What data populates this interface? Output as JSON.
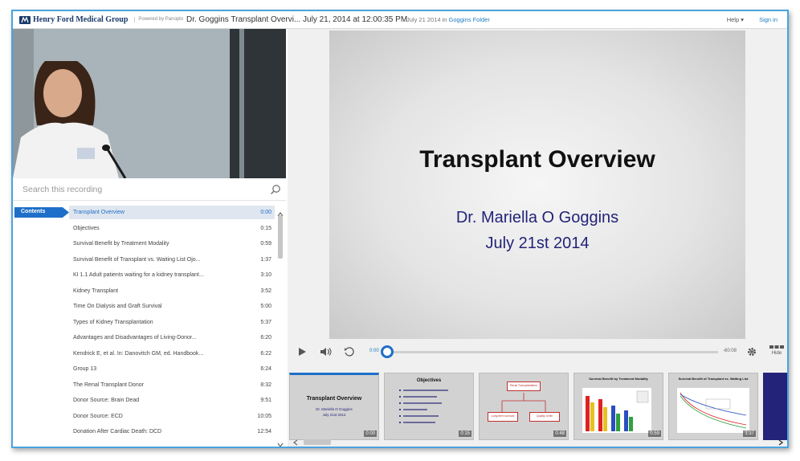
{
  "header": {
    "org_name": "Henry Ford Medical Group",
    "powered_by": "Powered by Panopto",
    "recording_title": "Dr. Goggins Transplant Overvi... July 21, 2014 at 12:00:35 PM",
    "date_in": "July 21 2014 in",
    "folder": "Goggins Folder",
    "help": "Help ▾",
    "sign_in": "Sign in"
  },
  "search": {
    "placeholder": "Search this recording"
  },
  "contents_tab": "Contents",
  "toc": [
    {
      "label": "Transplant Overview",
      "time": "0:00"
    },
    {
      "label": "Objectives",
      "time": "0:15"
    },
    {
      "label": "Survival Benefit by Treatment Modality",
      "time": "0:59"
    },
    {
      "label": "Survival Benefit of Transplant vs. Waiting List Ojo...",
      "time": "1:37"
    },
    {
      "label": "KI 1.1 Adult patients waiting for a kidney transplant...",
      "time": "3:10"
    },
    {
      "label": "Kidney Transplant",
      "time": "3:52"
    },
    {
      "label": "Time On Dialysis and Graft Survival",
      "time": "5:00"
    },
    {
      "label": "Types of Kidney Transplantation",
      "time": "5:37"
    },
    {
      "label": "Advantages and Disadvantages of Living-Donor...",
      "time": "6:20"
    },
    {
      "label": "Kendrick E, et al. In: Danovitch GM, ed. Handbook...",
      "time": "6:22"
    },
    {
      "label": "Group 13",
      "time": "6:24"
    },
    {
      "label": "The Renal Transplant Donor",
      "time": "8:32"
    },
    {
      "label": "Donor Source: Brain Dead",
      "time": "9:51"
    },
    {
      "label": "Donor Source: ECD",
      "time": "10:05"
    },
    {
      "label": "Donation After Cardiac Death: DCD",
      "time": "12:54"
    }
  ],
  "slide": {
    "title": "Transplant Overview",
    "presenter": "Dr. Mariella O Goggins",
    "date": "July 21st 2014"
  },
  "player": {
    "elapsed": "0:00",
    "remaining": "-60:08",
    "hide_label": "Hide",
    "progress": 0
  },
  "thumbnails": [
    {
      "title": "Transplant Overview",
      "sub1": "Dr. Mariella O Goggins",
      "sub2": "July 21st 2014",
      "time": "0:00"
    },
    {
      "title": "Objectives",
      "time": "0:15"
    },
    {
      "title": "Renal Transplantation",
      "left": "Long term survival",
      "right": "Quality of life",
      "time": "0:48"
    },
    {
      "title": "Survival Benefit by Treatment Modality",
      "time": "0:59"
    },
    {
      "title": "Survival Benefit of Transplant vs. Waiting List",
      "time": "1:37"
    }
  ],
  "colors": {
    "accent": "#1e6fc8",
    "frame": "#4aa3df",
    "slide_sub": "#23237a"
  }
}
